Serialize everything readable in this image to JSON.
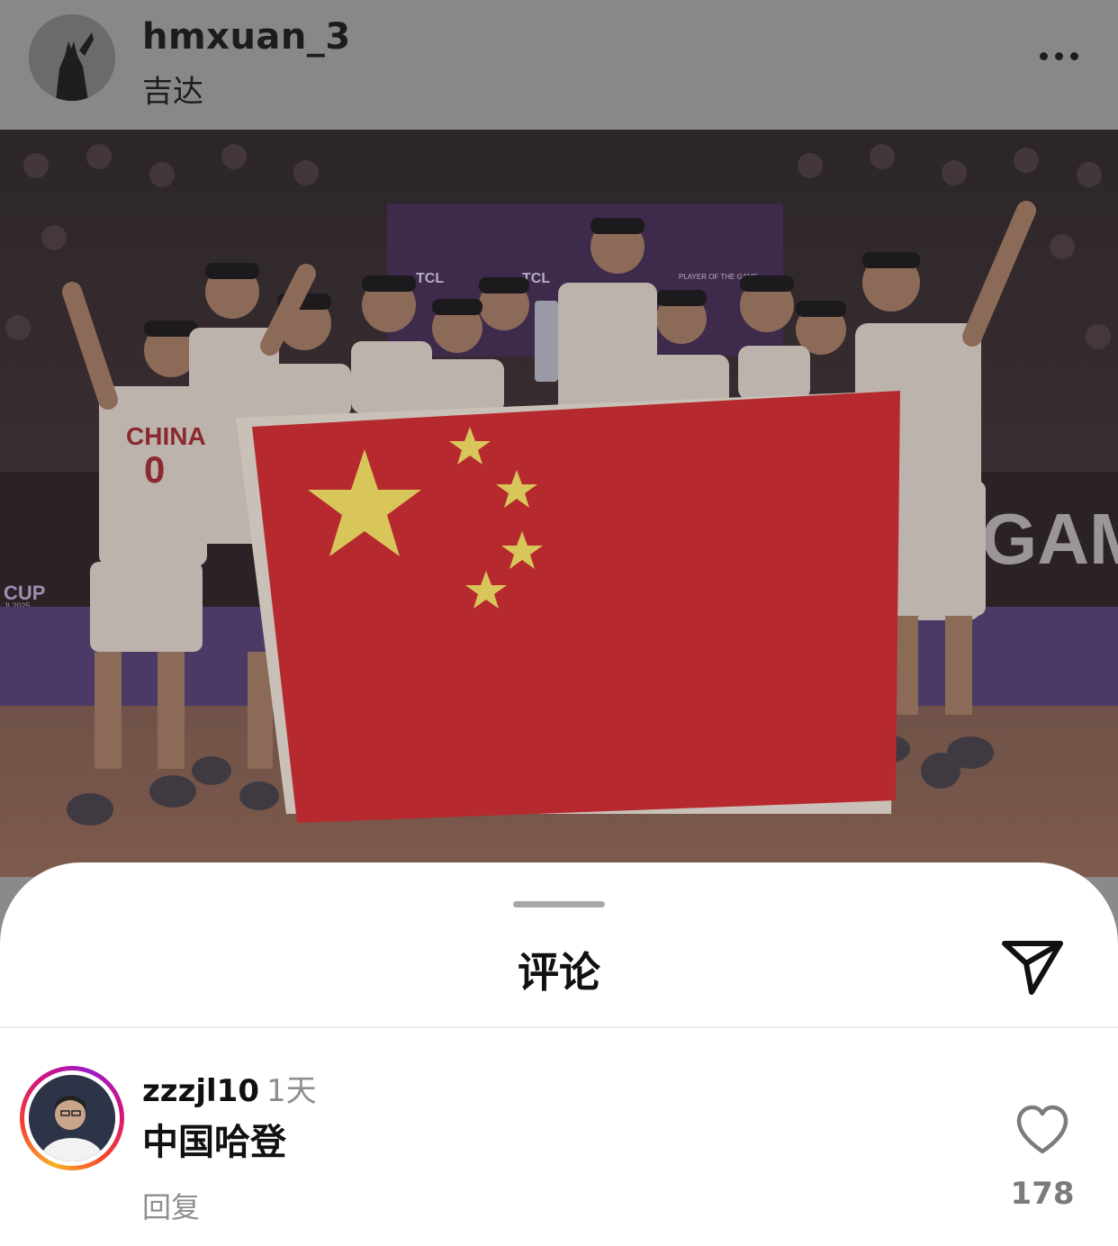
{
  "post": {
    "username": "hmxuan_3",
    "location": "吉达",
    "more_icon": "more-horizontal-icon"
  },
  "photo": {
    "banner_tcl": "TCL",
    "banner_potg": "PLAYER OF THE GAME",
    "board_big_text": "GAM",
    "cup_text": "CUP",
    "cup_year": "JI 2025",
    "jersey_text": "CHINA",
    "jersey_number": "0"
  },
  "sheet": {
    "title": "评论",
    "share_icon": "paper-plane-icon"
  },
  "comment": {
    "username": "zzzjl10",
    "time": "1天",
    "text": "中国哈登",
    "reply_label": "回复",
    "like_icon": "heart-outline-icon",
    "like_count": "178"
  },
  "colors": {
    "dim_overlay": "#888888",
    "flag_red": "#c0262d",
    "flag_star": "#d8c65a",
    "story_ring": [
      "#f9b025",
      "#f5422f",
      "#d3127f"
    ],
    "muted_text": "#8e8e8e"
  }
}
